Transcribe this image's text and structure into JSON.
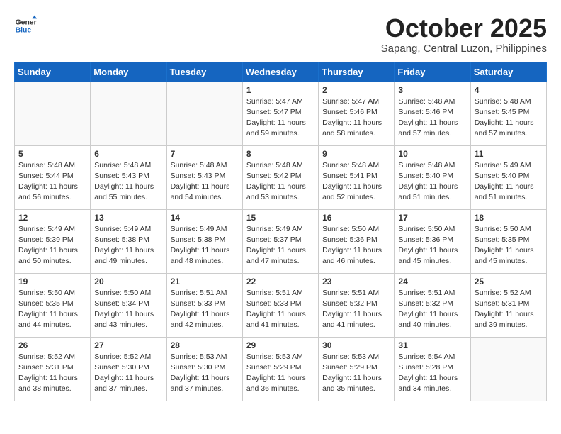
{
  "header": {
    "logo_general": "General",
    "logo_blue": "Blue",
    "month_year": "October 2025",
    "location": "Sapang, Central Luzon, Philippines"
  },
  "days_of_week": [
    "Sunday",
    "Monday",
    "Tuesday",
    "Wednesday",
    "Thursday",
    "Friday",
    "Saturday"
  ],
  "weeks": [
    [
      {
        "day": "",
        "info": ""
      },
      {
        "day": "",
        "info": ""
      },
      {
        "day": "",
        "info": ""
      },
      {
        "day": "1",
        "info": "Sunrise: 5:47 AM\nSunset: 5:47 PM\nDaylight: 11 hours\nand 59 minutes."
      },
      {
        "day": "2",
        "info": "Sunrise: 5:47 AM\nSunset: 5:46 PM\nDaylight: 11 hours\nand 58 minutes."
      },
      {
        "day": "3",
        "info": "Sunrise: 5:48 AM\nSunset: 5:46 PM\nDaylight: 11 hours\nand 57 minutes."
      },
      {
        "day": "4",
        "info": "Sunrise: 5:48 AM\nSunset: 5:45 PM\nDaylight: 11 hours\nand 57 minutes."
      }
    ],
    [
      {
        "day": "5",
        "info": "Sunrise: 5:48 AM\nSunset: 5:44 PM\nDaylight: 11 hours\nand 56 minutes."
      },
      {
        "day": "6",
        "info": "Sunrise: 5:48 AM\nSunset: 5:43 PM\nDaylight: 11 hours\nand 55 minutes."
      },
      {
        "day": "7",
        "info": "Sunrise: 5:48 AM\nSunset: 5:43 PM\nDaylight: 11 hours\nand 54 minutes."
      },
      {
        "day": "8",
        "info": "Sunrise: 5:48 AM\nSunset: 5:42 PM\nDaylight: 11 hours\nand 53 minutes."
      },
      {
        "day": "9",
        "info": "Sunrise: 5:48 AM\nSunset: 5:41 PM\nDaylight: 11 hours\nand 52 minutes."
      },
      {
        "day": "10",
        "info": "Sunrise: 5:48 AM\nSunset: 5:40 PM\nDaylight: 11 hours\nand 51 minutes."
      },
      {
        "day": "11",
        "info": "Sunrise: 5:49 AM\nSunset: 5:40 PM\nDaylight: 11 hours\nand 51 minutes."
      }
    ],
    [
      {
        "day": "12",
        "info": "Sunrise: 5:49 AM\nSunset: 5:39 PM\nDaylight: 11 hours\nand 50 minutes."
      },
      {
        "day": "13",
        "info": "Sunrise: 5:49 AM\nSunset: 5:38 PM\nDaylight: 11 hours\nand 49 minutes."
      },
      {
        "day": "14",
        "info": "Sunrise: 5:49 AM\nSunset: 5:38 PM\nDaylight: 11 hours\nand 48 minutes."
      },
      {
        "day": "15",
        "info": "Sunrise: 5:49 AM\nSunset: 5:37 PM\nDaylight: 11 hours\nand 47 minutes."
      },
      {
        "day": "16",
        "info": "Sunrise: 5:50 AM\nSunset: 5:36 PM\nDaylight: 11 hours\nand 46 minutes."
      },
      {
        "day": "17",
        "info": "Sunrise: 5:50 AM\nSunset: 5:36 PM\nDaylight: 11 hours\nand 45 minutes."
      },
      {
        "day": "18",
        "info": "Sunrise: 5:50 AM\nSunset: 5:35 PM\nDaylight: 11 hours\nand 45 minutes."
      }
    ],
    [
      {
        "day": "19",
        "info": "Sunrise: 5:50 AM\nSunset: 5:35 PM\nDaylight: 11 hours\nand 44 minutes."
      },
      {
        "day": "20",
        "info": "Sunrise: 5:50 AM\nSunset: 5:34 PM\nDaylight: 11 hours\nand 43 minutes."
      },
      {
        "day": "21",
        "info": "Sunrise: 5:51 AM\nSunset: 5:33 PM\nDaylight: 11 hours\nand 42 minutes."
      },
      {
        "day": "22",
        "info": "Sunrise: 5:51 AM\nSunset: 5:33 PM\nDaylight: 11 hours\nand 41 minutes."
      },
      {
        "day": "23",
        "info": "Sunrise: 5:51 AM\nSunset: 5:32 PM\nDaylight: 11 hours\nand 41 minutes."
      },
      {
        "day": "24",
        "info": "Sunrise: 5:51 AM\nSunset: 5:32 PM\nDaylight: 11 hours\nand 40 minutes."
      },
      {
        "day": "25",
        "info": "Sunrise: 5:52 AM\nSunset: 5:31 PM\nDaylight: 11 hours\nand 39 minutes."
      }
    ],
    [
      {
        "day": "26",
        "info": "Sunrise: 5:52 AM\nSunset: 5:31 PM\nDaylight: 11 hours\nand 38 minutes."
      },
      {
        "day": "27",
        "info": "Sunrise: 5:52 AM\nSunset: 5:30 PM\nDaylight: 11 hours\nand 37 minutes."
      },
      {
        "day": "28",
        "info": "Sunrise: 5:53 AM\nSunset: 5:30 PM\nDaylight: 11 hours\nand 37 minutes."
      },
      {
        "day": "29",
        "info": "Sunrise: 5:53 AM\nSunset: 5:29 PM\nDaylight: 11 hours\nand 36 minutes."
      },
      {
        "day": "30",
        "info": "Sunrise: 5:53 AM\nSunset: 5:29 PM\nDaylight: 11 hours\nand 35 minutes."
      },
      {
        "day": "31",
        "info": "Sunrise: 5:54 AM\nSunset: 5:28 PM\nDaylight: 11 hours\nand 34 minutes."
      },
      {
        "day": "",
        "info": ""
      }
    ]
  ]
}
